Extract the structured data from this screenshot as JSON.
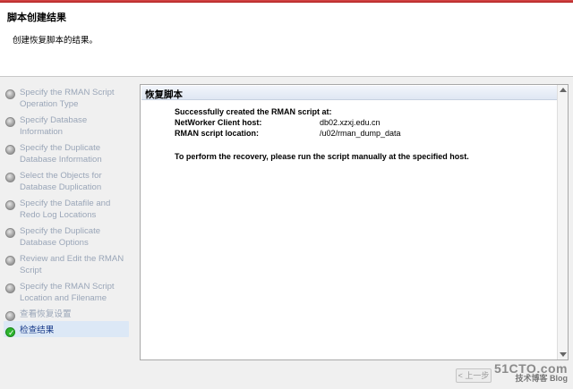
{
  "header": {
    "title": "脚本创建结果",
    "subtitle": "创建恢复脚本的结果。"
  },
  "steps": [
    {
      "label": "Specify the RMAN Script Operation Type",
      "state": "pending"
    },
    {
      "label": "Specify Database Information",
      "state": "pending"
    },
    {
      "label": "Specify the Duplicate Database Information",
      "state": "pending"
    },
    {
      "label": "Select the Objects for Database Duplication",
      "state": "pending"
    },
    {
      "label": "Specify the Datafile and Redo Log Locations",
      "state": "pending"
    },
    {
      "label": "Specify the Duplicate Database Options",
      "state": "pending"
    },
    {
      "label": "Review and Edit the RMAN Script",
      "state": "pending"
    },
    {
      "label": "Specify the RMAN Script Location and Filename",
      "state": "pending"
    },
    {
      "label": "查看恢复设置",
      "state": "pending"
    },
    {
      "label": "检查结果",
      "state": "current"
    }
  ],
  "panel": {
    "title": "恢复脚本",
    "success": "Successfully created the RMAN script at:",
    "host_label": "NetWorker Client host:",
    "host_value": "db02.xzxj.edu.cn",
    "location_label": "RMAN script location:",
    "location_value": "/u02/rman_dump_data",
    "instruction": "To perform the recovery, please run the script manually at the specified host."
  },
  "footer": {
    "back_label": "< 上一步"
  },
  "watermark": {
    "site": "51CTO.com",
    "sub": "技术博客 Blog"
  },
  "colors": {
    "accent_red": "#c0392b",
    "step_text": "#9aa6b8",
    "active_bg": "#dce8f6",
    "check_green": "#2eb52e"
  }
}
